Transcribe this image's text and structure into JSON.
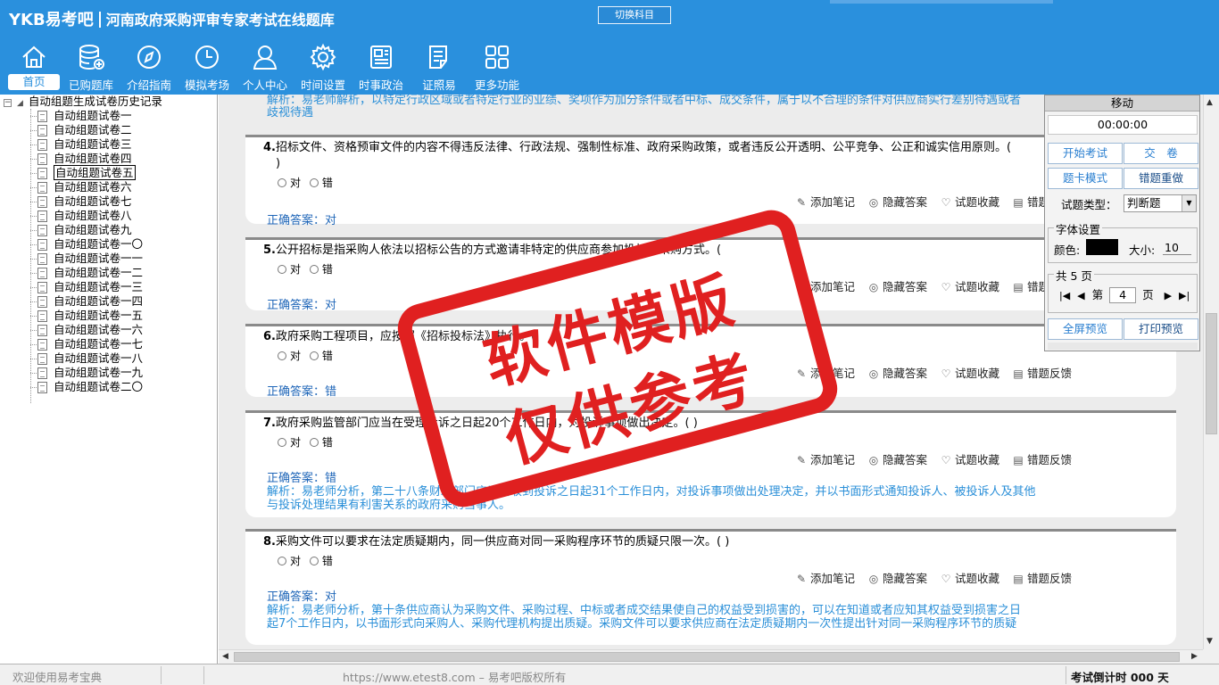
{
  "app": {
    "brand": "YKB易考吧",
    "title": "河南政府采购评审专家考试在线题库",
    "switch_subject": "切换科目"
  },
  "nav": [
    {
      "label": "首页",
      "icon": "home-icon"
    },
    {
      "label": "已购题库",
      "icon": "database-icon"
    },
    {
      "label": "介绍指南",
      "icon": "compass-icon"
    },
    {
      "label": "模拟考场",
      "icon": "clock-icon"
    },
    {
      "label": "个人中心",
      "icon": "user-icon"
    },
    {
      "label": "时间设置",
      "icon": "gear-icon"
    },
    {
      "label": "时事政治",
      "icon": "newspaper-icon"
    },
    {
      "label": "证照易",
      "icon": "checklist-icon"
    },
    {
      "label": "更多功能",
      "icon": "grid-icon"
    }
  ],
  "tree": {
    "root": "自动组题生成试卷历史记录",
    "items": [
      "自动组题试卷一",
      "自动组题试卷二",
      "自动组题试卷三",
      "自动组题试卷四",
      "自动组题试卷五",
      "自动组题试卷六",
      "自动组题试卷七",
      "自动组题试卷八",
      "自动组题试卷九",
      "自动组题试卷一〇",
      "自动组题试卷一一",
      "自动组题试卷一二",
      "自动组题试卷一三",
      "自动组题试卷一四",
      "自动组题试卷一五",
      "自动组题试卷一六",
      "自动组题试卷一七",
      "自动组题试卷一八",
      "自动组题试卷一九",
      "自动组题试卷二〇"
    ],
    "selected_index": 4
  },
  "prev_analysis": {
    "line1": "解析：易老师解析，以特定行政区域或者特定行业的业绩、奖项作为加分条件或者中标、成交条件，属于以不合理的条件对供应商实行差别待遇或者",
    "line2": "歧视待遇"
  },
  "actions": {
    "note": "添加笔记",
    "hide": "隐藏答案",
    "fav": "试题收藏",
    "feedback": "错题反馈"
  },
  "options": {
    "true": "对",
    "false": "错"
  },
  "questions": [
    {
      "num": "4.",
      "text": "招标文件、资格预审文件的内容不得违反法律、行政法规、强制性标准、政府采购政策，或者违反公开透明、公平竞争、公正和诚实信用原则。(",
      "text2": ")",
      "answer": "正确答案：对",
      "analysis": ""
    },
    {
      "num": "5.",
      "text": "公开招标是指采购人依法以招标公告的方式邀请非特定的供应商参加投标的采购方式。(",
      "text2": "",
      "answer": "正确答案：对",
      "analysis": ""
    },
    {
      "num": "6.",
      "text": "政府采购工程项目，应按照《招标投标法》执行。(",
      "text2": "",
      "answer": "正确答案：错",
      "analysis": ""
    },
    {
      "num": "7.",
      "text": "政府采购监管部门应当在受理投诉之日起20个工作日内，对投诉事项做出决定。( )",
      "text2": "",
      "answer": "正确答案：错",
      "analysis": "解析：易老师分析，第二十八条财政部门应当自收到投诉之日起31个工作日内，对投诉事项做出处理决定，并以书面形式通知投诉人、被投诉人及其他",
      "analysis2": "与投诉处理结果有利害关系的政府采购当事人。"
    },
    {
      "num": "8.",
      "text": "采购文件可以要求在法定质疑期内，同一供应商对同一采购程序环节的质疑只限一次。( )",
      "text2": "",
      "answer": "正确答案：对",
      "analysis": "解析：易老师分析，第十条供应商认为采购文件、采购过程、中标或者成交结果使自己的权益受到损害的，可以在知道或者应知其权益受到损害之日",
      "analysis2": "起7个工作日内，以书面形式向采购人、采购代理机构提出质疑。采购文件可以要求供应商在法定质疑期内一次性提出针对同一采购程序环节的质疑"
    }
  ],
  "panel": {
    "title": "移动",
    "timer": "00:00:00",
    "start_exam": "开始考试",
    "submit": "交　卷",
    "card_mode": "题卡模式",
    "redo_wrong": "错题重做",
    "qtype_label": "试题类型：",
    "qtype_value": "判断题",
    "font_legend": "字体设置",
    "color_label": "颜色:",
    "color_value": "#000000",
    "size_label": "大小:",
    "size_value": "10",
    "pages_legend": "共 5 页",
    "page_prefix": "第",
    "page_value": "4",
    "page_suffix": "页",
    "fullscreen": "全屏预览",
    "print": "打印预览"
  },
  "watermark": {
    "line1": "软件模版",
    "line2": "仅供参考"
  },
  "status": {
    "welcome": "欢迎使用易考宝典",
    "copyright": "https://www.etest8.com – 易考吧版权所有",
    "countdown": "考试倒计时 000 天"
  },
  "colors": {
    "header": "#2a90dd",
    "link": "#2a8fd8",
    "stamp": "#e02020"
  }
}
